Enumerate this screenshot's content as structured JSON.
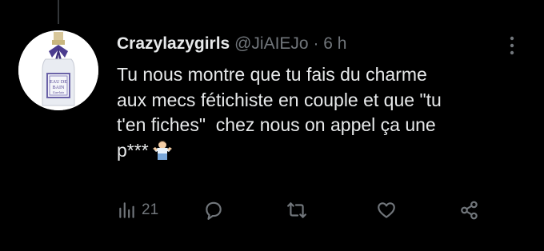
{
  "tweet": {
    "display_name": "Crazylazygirls",
    "handle": "@JiAIEJo",
    "separator": "·",
    "time": "6 h",
    "text": "Tu nous montre que tu fais du charme\naux mecs fétichiste en couple et que \"tu\nt'en fiches\"  chez nous on appel ça une\np***",
    "emoji": "man-shrugging-emoji",
    "avatar_label_line1": "EAU DE",
    "avatar_label_line2": "BAIN",
    "avatar_label_line3": "Guerlain"
  },
  "actions": {
    "views_count": "21",
    "reply_icon": "reply-icon",
    "retweet_icon": "retweet-icon",
    "like_icon": "heart-icon",
    "share_icon": "share-icon"
  },
  "colors": {
    "background": "#000000",
    "text": "#e7e9ea",
    "secondary": "#71767b",
    "thread_line": "#333639"
  }
}
